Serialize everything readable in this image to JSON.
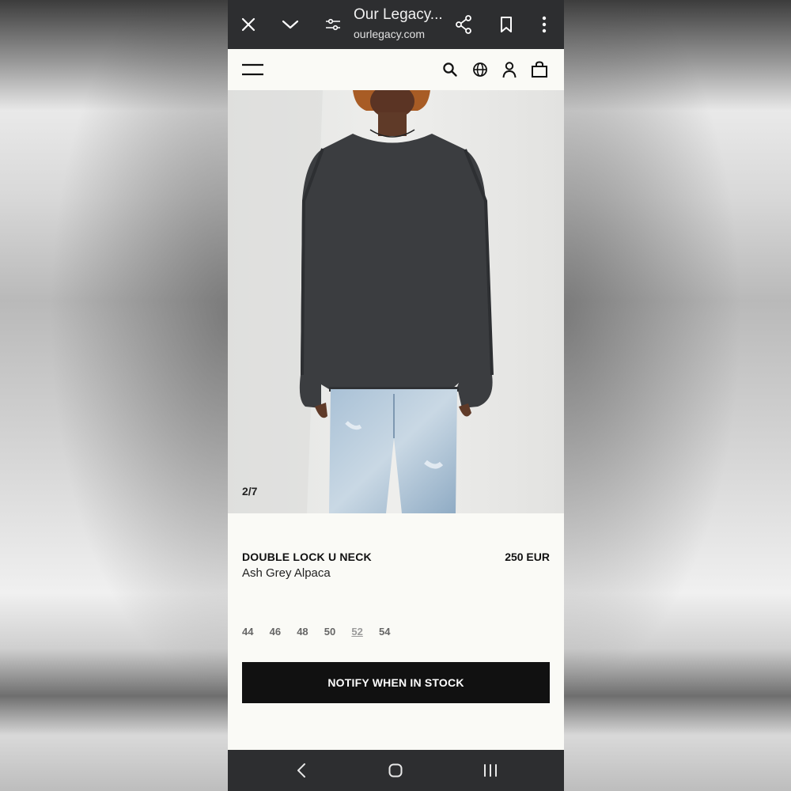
{
  "browser": {
    "tab_title": "Our Legacy...",
    "url": "ourlegacy.com",
    "icons": [
      "close-icon",
      "chevron-down-icon",
      "tune-icon",
      "share-icon",
      "bookmark-icon",
      "more-vert-icon"
    ]
  },
  "site_header": {
    "icons": [
      "menu-icon",
      "search-icon",
      "globe-icon",
      "account-icon",
      "bag-icon"
    ]
  },
  "gallery": {
    "counter": "2/7"
  },
  "product": {
    "name": "DOUBLE LOCK U NECK",
    "color": "Ash Grey Alpaca",
    "price": "250 EUR",
    "sizes": [
      "44",
      "46",
      "48",
      "50",
      "52",
      "54"
    ],
    "underlined_size": "52",
    "notify_label": "NOTIFY WHEN IN STOCK"
  },
  "system_nav": {
    "icons": [
      "back-icon",
      "home-icon",
      "recents-icon"
    ]
  },
  "colors": {
    "bar_dark": "#2d2e30",
    "page_bg": "#fafaf6",
    "button_bg": "#111111"
  }
}
